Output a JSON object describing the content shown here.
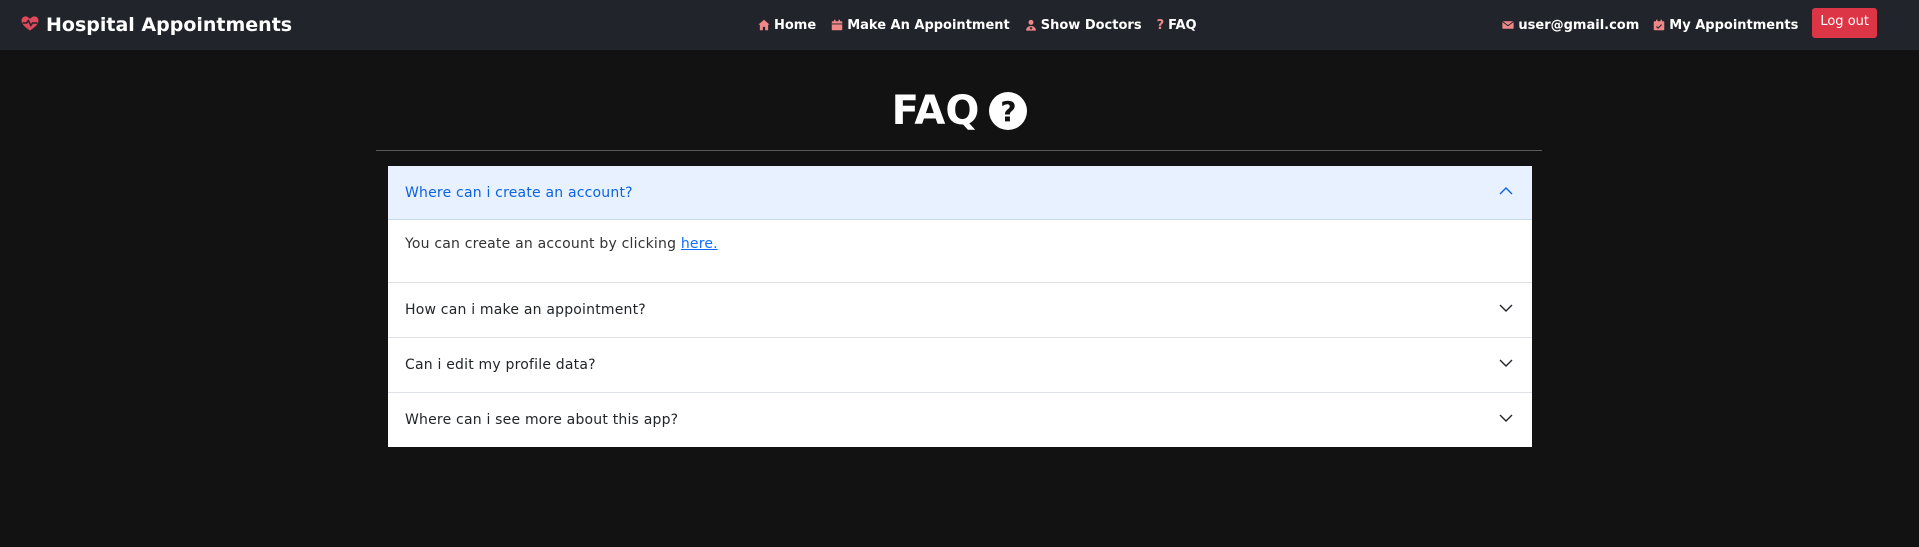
{
  "navbar": {
    "brand": "Hospital Appointments",
    "brand_icon": "heart-pulse-icon",
    "links": [
      {
        "label": "Home",
        "icon": "home-icon"
      },
      {
        "label": "Make An Appointment",
        "icon": "calendar-icon"
      },
      {
        "label": "Show Doctors",
        "icon": "doctor-icon"
      },
      {
        "label": "FAQ",
        "icon": "question-icon"
      }
    ],
    "user_email": "user@gmail.com",
    "my_appointments": "My Appointments",
    "logout": "Log out"
  },
  "page": {
    "title": "FAQ"
  },
  "faq": {
    "items": [
      {
        "question": "Where can i create an account?",
        "answer_prefix": "You can create an account by clicking ",
        "answer_link": "here.",
        "expanded": true
      },
      {
        "question": "How can i make an appointment?",
        "expanded": false
      },
      {
        "question": "Can i edit my profile data?",
        "expanded": false
      },
      {
        "question": "Where can i see more about this app?",
        "expanded": false
      }
    ]
  },
  "colors": {
    "navbar_bg": "#21252b",
    "page_bg": "#121212",
    "icon_accent": "#f08787",
    "logout_bg": "#dc3545",
    "accordion_active_bg": "#e7f1ff",
    "accordion_active_text": "#0c63e4"
  }
}
